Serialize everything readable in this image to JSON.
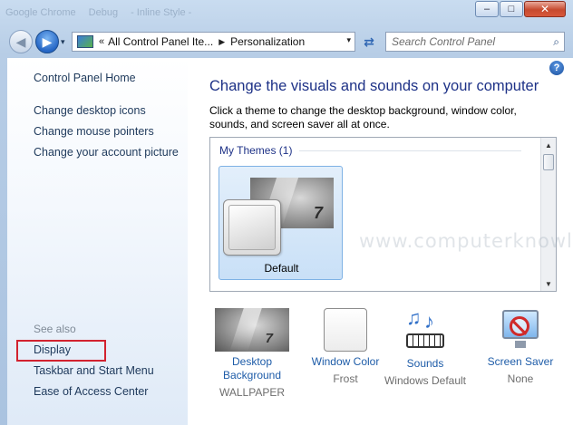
{
  "window": {
    "min_glyph": "–",
    "max_glyph": "□",
    "close_glyph": "✕",
    "background_tabs": [
      "Google Chrome",
      "Debug",
      "- Inline Style -"
    ]
  },
  "navbar": {
    "back_glyph": "◀",
    "forward_glyph": "▶",
    "dropdown_glyph": "▾",
    "address": {
      "overflow_glyph": "«",
      "crumbs": [
        "All Control Panel Ite...",
        "Personalization"
      ],
      "crumb_arrow": "▶",
      "dropdown_glyph": "▾"
    },
    "refresh_glyph": "⇄",
    "search": {
      "placeholder": "Search Control Panel",
      "value": "",
      "icon": "search-icon"
    }
  },
  "sidebar": {
    "home_link": "Control Panel Home",
    "links": [
      "Change desktop icons",
      "Change mouse pointers",
      "Change your account picture"
    ],
    "see_also_label": "See also",
    "see_also_links": [
      "Display",
      "Taskbar and Start Menu",
      "Ease of Access Center"
    ],
    "highlight_color": "#d2222f"
  },
  "main": {
    "help_glyph": "?",
    "title": "Change the visuals and sounds on your computer",
    "description": "Click a theme to change the desktop background, window color, sounds, and screen saver all at once.",
    "themes": {
      "group_label": "My Themes (1)",
      "items": [
        {
          "name": "Default",
          "selected": true
        }
      ],
      "scroll_up_glyph": "▲",
      "scroll_down_glyph": "▼"
    },
    "watermark": "www.computerknowledge.net",
    "settings": [
      {
        "title": "Desktop Background",
        "value": "WALLPAPER",
        "icon": "wallpaper-icon"
      },
      {
        "title": "Window Color",
        "value": "Frost",
        "icon": "window-color-icon"
      },
      {
        "title": "Sounds",
        "value": "Windows Default",
        "icon": "sounds-icon"
      },
      {
        "title": "Screen Saver",
        "value": "None",
        "icon": "screen-saver-icon"
      }
    ],
    "title_color": "#1e3287",
    "link_color": "#1e5ca8"
  }
}
